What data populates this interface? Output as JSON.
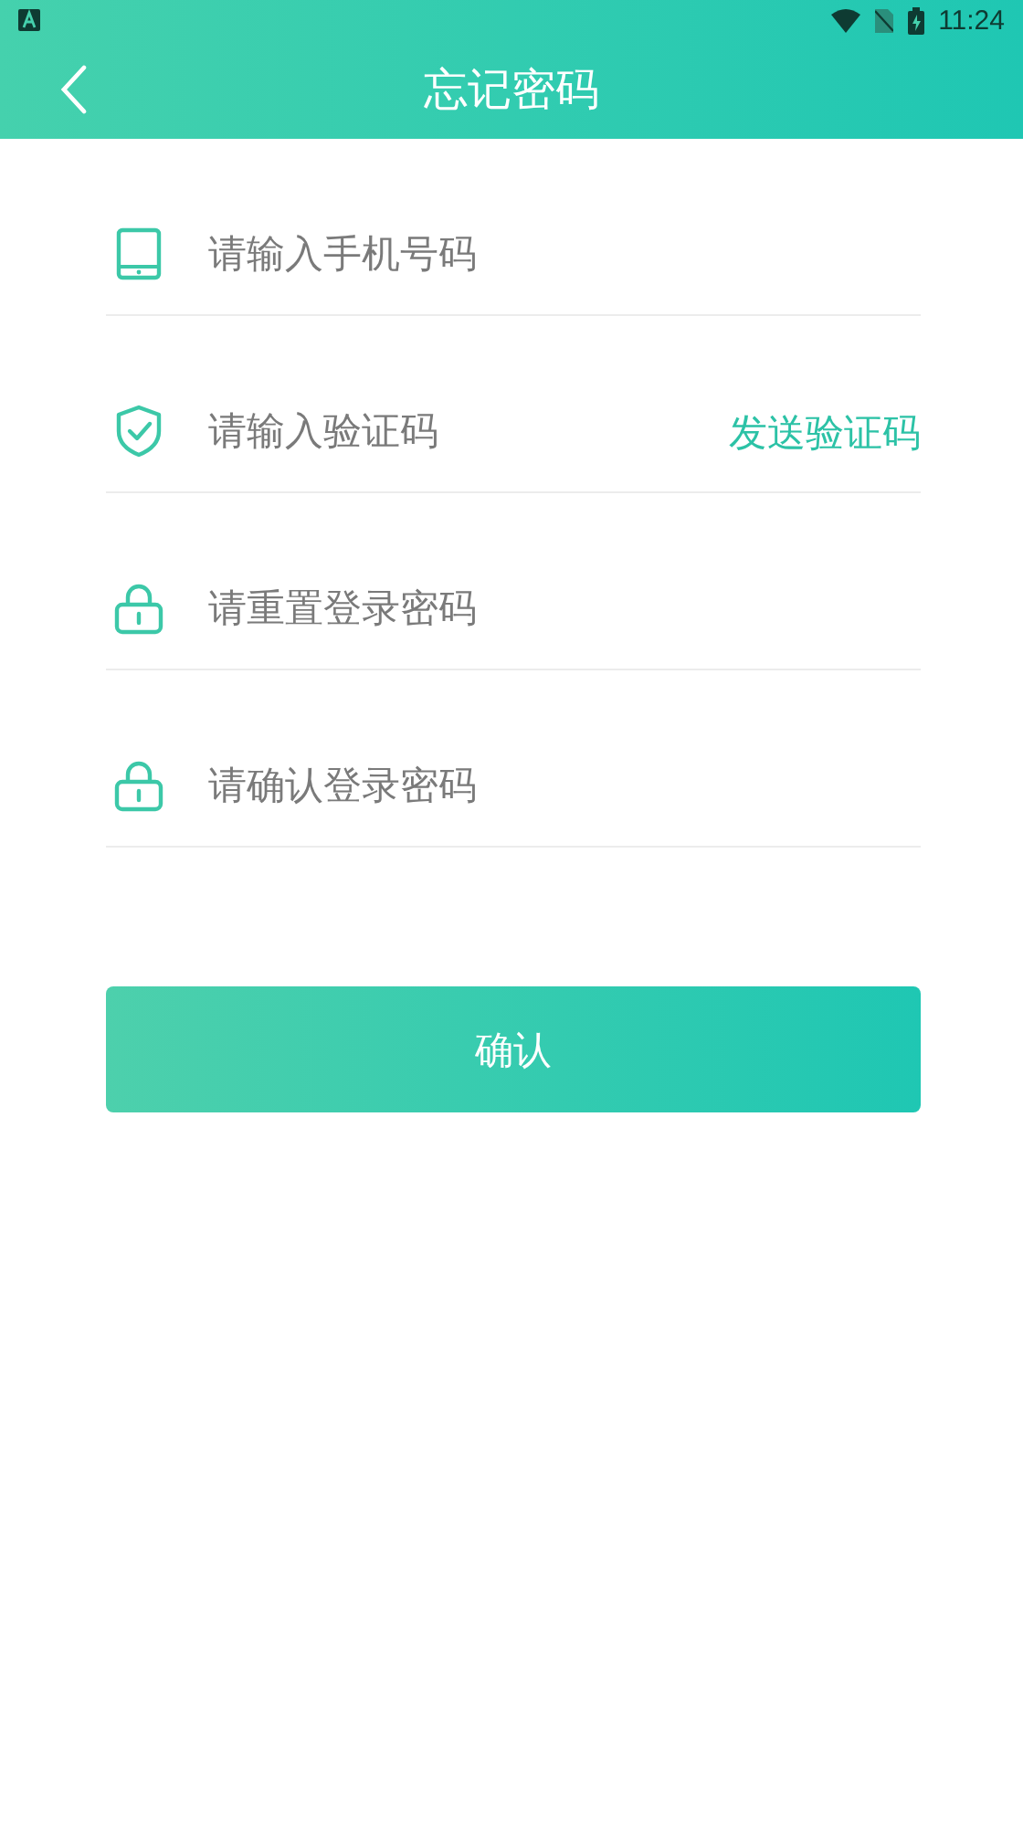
{
  "status_bar": {
    "time": "11:24"
  },
  "header": {
    "title": "忘记密码"
  },
  "fields": [
    {
      "kind": "phone",
      "placeholder": "请输入手机号码"
    },
    {
      "kind": "code",
      "placeholder": "请输入验证码",
      "action": "发送验证码"
    },
    {
      "kind": "lock",
      "placeholder": "请重置登录密码"
    },
    {
      "kind": "lock",
      "placeholder": "请确认登录密码"
    }
  ],
  "submit_button": {
    "label": "确认"
  }
}
